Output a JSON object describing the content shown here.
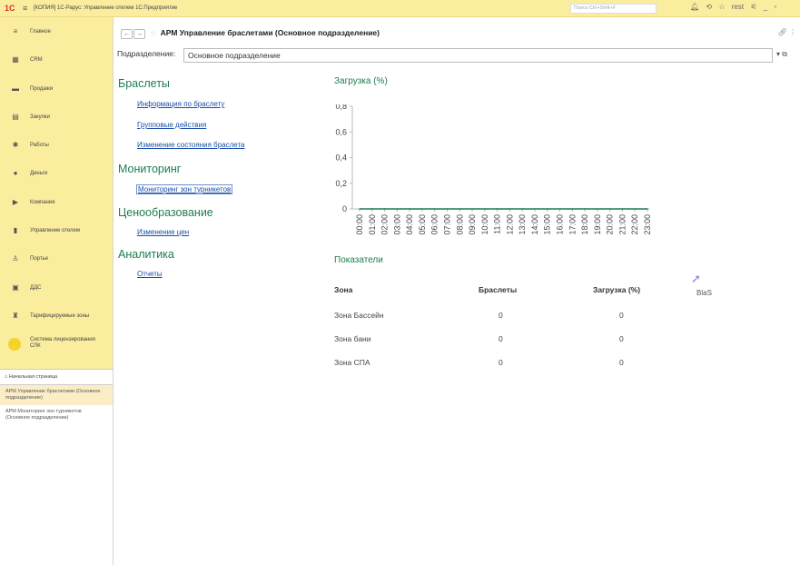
{
  "window": {
    "title": "[КОПИЯ] 1С-Рарус: Управление отелем 1С:Предприятие",
    "search_placeholder": "Поиск Ctrl+Shift+F",
    "user": "rest"
  },
  "sidebar": {
    "sections": [
      {
        "label": "Главное",
        "icon": "menu-icon",
        "glyph": "≡"
      },
      {
        "label": "CRM",
        "icon": "crm-icon",
        "glyph": "▦"
      },
      {
        "label": "Продажи",
        "icon": "sales-icon",
        "glyph": "▬"
      },
      {
        "label": "Закупки",
        "icon": "purchases-icon",
        "glyph": "▤"
      },
      {
        "label": "Работы",
        "icon": "works-icon",
        "glyph": "✱"
      },
      {
        "label": "Деньги",
        "icon": "money-icon",
        "glyph": "●"
      },
      {
        "label": "Компания",
        "icon": "company-icon",
        "glyph": "▶"
      },
      {
        "label": "Управление отелем",
        "icon": "hotel-icon",
        "glyph": "▮"
      },
      {
        "label": "Портье",
        "icon": "porter-icon",
        "glyph": "♙"
      },
      {
        "label": "ДДС",
        "icon": "cashflow-icon",
        "glyph": "▣"
      },
      {
        "label": "Тарифицируемые зоны",
        "icon": "zones-icon",
        "glyph": "♜"
      },
      {
        "label": "Система лицензирования СЛК",
        "icon": "license-icon",
        "glyph": ""
      }
    ],
    "home": "Начальная страница",
    "opened": [
      "АРМ Управление браслетами (Основное подразделение)",
      "АРМ Мониторинг зон турникетов (Основное подразделение)"
    ]
  },
  "form": {
    "title": "АРМ Управление браслетами (Основное подразделение)",
    "subdivision_label": "Подразделение:",
    "subdivision_value": "Основное подразделение"
  },
  "groups": {
    "bracelets": {
      "title": "Браслеты",
      "links": [
        "Информация по браслету",
        "Групповые действия",
        "Изменение состояния браслета"
      ]
    },
    "monitoring": {
      "title": "Мониторинг",
      "links": [
        "Мониторинг зон турникетов"
      ]
    },
    "pricing": {
      "title": "Ценообразование",
      "links": [
        "Изменение цен"
      ]
    },
    "analytics": {
      "title": "Аналитика",
      "links": [
        "Отчеты"
      ]
    }
  },
  "chart_data": {
    "type": "line",
    "title": "Загрузка (%)",
    "categories": [
      "00:00",
      "01:00",
      "02:00",
      "03:00",
      "04:00",
      "05:00",
      "06:00",
      "07:00",
      "08:00",
      "09:00",
      "10:00",
      "11:00",
      "12:00",
      "13:00",
      "14:00",
      "15:00",
      "16:00",
      "17:00",
      "18:00",
      "19:00",
      "20:00",
      "21:00",
      "22:00",
      "23:00"
    ],
    "values": [
      0,
      0,
      0,
      0,
      0,
      0,
      0,
      0,
      0,
      0,
      0,
      0,
      0,
      0,
      0,
      0,
      0,
      0,
      0,
      0,
      0,
      0,
      0,
      0
    ],
    "yticks": [
      "0",
      "0,2",
      "0,4",
      "0,6",
      "0,8"
    ],
    "ylim": [
      0,
      0.8
    ],
    "grid": false,
    "color": "#1d7d4f"
  },
  "indicators": {
    "title": "Показатели",
    "headers": [
      "Зона",
      "Браслеты",
      "Загрузка (%)"
    ],
    "rows": [
      [
        "Зона Бассейн",
        "0",
        "0"
      ],
      [
        "Зона бани",
        "0",
        "0"
      ],
      [
        "Зона СПА",
        "0",
        "0"
      ]
    ]
  },
  "overlay_text": "BlaS"
}
